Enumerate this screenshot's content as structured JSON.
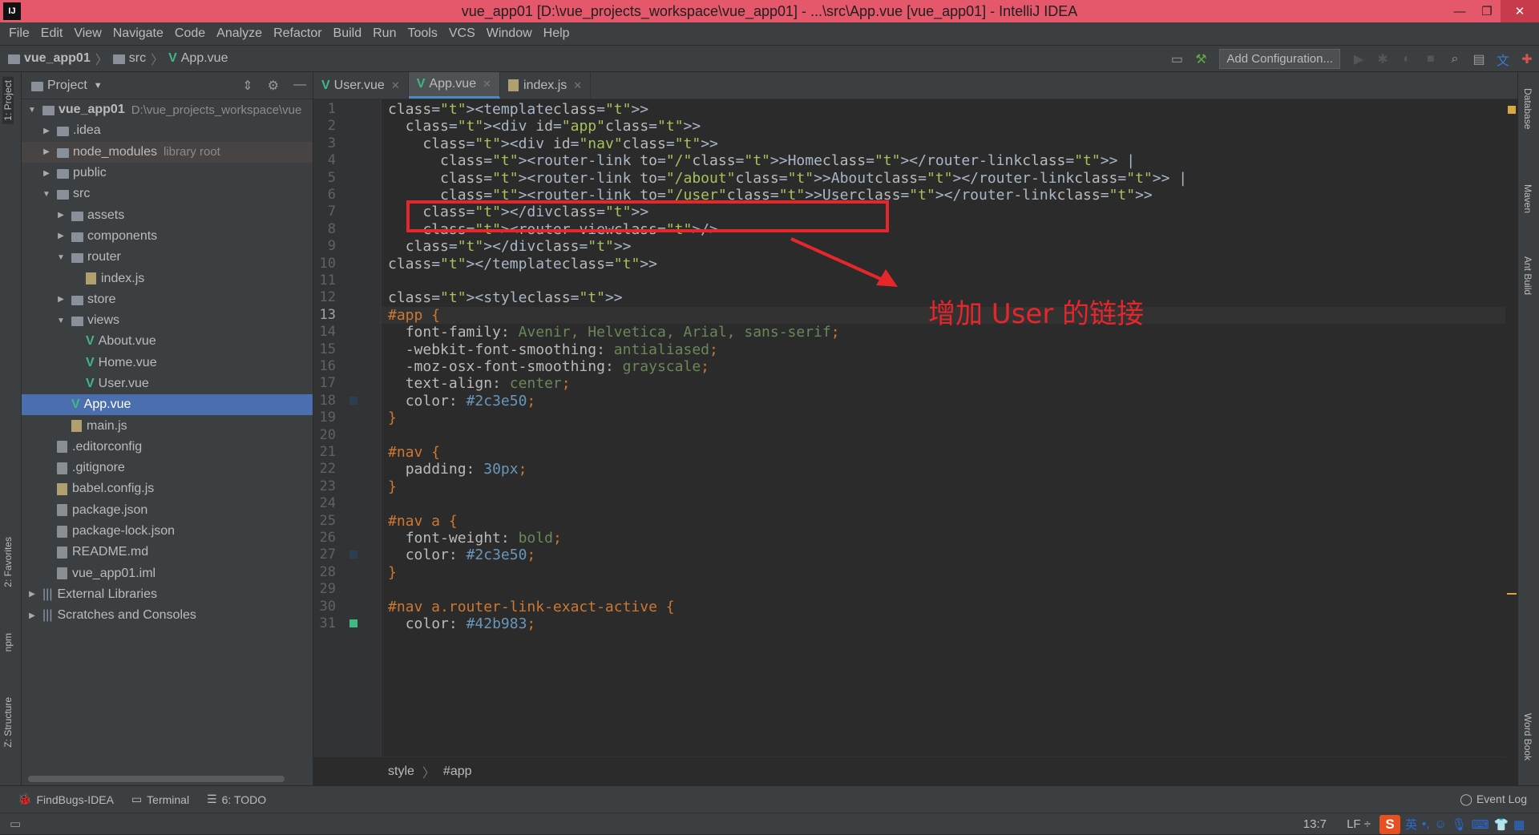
{
  "window": {
    "title": "vue_app01 [D:\\vue_projects_workspace\\vue_app01] - ...\\src\\App.vue [vue_app01] - IntelliJ IDEA",
    "minimize": "—",
    "maximize": "❐",
    "close": "✕"
  },
  "menu": [
    "File",
    "Edit",
    "View",
    "Navigate",
    "Code",
    "Analyze",
    "Refactor",
    "Build",
    "Run",
    "Tools",
    "VCS",
    "Window",
    "Help"
  ],
  "nav": {
    "project": "vue_app01",
    "folder": "src",
    "file": "App.vue",
    "add_config": "Add Configuration..."
  },
  "left_tabs": {
    "project": "1: Project",
    "favorites": "2: Favorites",
    "npm": "npm",
    "structure": "Z: Structure"
  },
  "right_tabs": {
    "database": "Database",
    "maven": "Maven",
    "ant": "Ant Build",
    "wordbook": "Word Book"
  },
  "project_panel": {
    "title": "Project",
    "tree": [
      {
        "label": "vue_app01",
        "hint": "D:\\vue_projects_workspace\\vue",
        "level": 0,
        "arrow": "▼",
        "icon": "folder"
      },
      {
        "label": ".idea",
        "level": 1,
        "arrow": "▶",
        "icon": "folder"
      },
      {
        "label": "node_modules",
        "hint": "library root",
        "level": 1,
        "arrow": "▶",
        "icon": "folder"
      },
      {
        "label": "public",
        "level": 1,
        "arrow": "▶",
        "icon": "folder"
      },
      {
        "label": "src",
        "level": 1,
        "arrow": "▼",
        "icon": "folder"
      },
      {
        "label": "assets",
        "level": 2,
        "arrow": "▶",
        "icon": "folder"
      },
      {
        "label": "components",
        "level": 2,
        "arrow": "▶",
        "icon": "folder"
      },
      {
        "label": "router",
        "level": 2,
        "arrow": "▼",
        "icon": "folder"
      },
      {
        "label": "index.js",
        "level": 3,
        "arrow": "",
        "icon": "js"
      },
      {
        "label": "store",
        "level": 2,
        "arrow": "▶",
        "icon": "folder"
      },
      {
        "label": "views",
        "level": 2,
        "arrow": "▼",
        "icon": "folder"
      },
      {
        "label": "About.vue",
        "level": 3,
        "arrow": "",
        "icon": "vue"
      },
      {
        "label": "Home.vue",
        "level": 3,
        "arrow": "",
        "icon": "vue"
      },
      {
        "label": "User.vue",
        "level": 3,
        "arrow": "",
        "icon": "vue"
      },
      {
        "label": "App.vue",
        "level": 2,
        "arrow": "",
        "icon": "vue",
        "selected": true
      },
      {
        "label": "main.js",
        "level": 2,
        "arrow": "",
        "icon": "js"
      },
      {
        "label": ".editorconfig",
        "level": 1,
        "arrow": "",
        "icon": "file"
      },
      {
        "label": ".gitignore",
        "level": 1,
        "arrow": "",
        "icon": "file"
      },
      {
        "label": "babel.config.js",
        "level": 1,
        "arrow": "",
        "icon": "js"
      },
      {
        "label": "package.json",
        "level": 1,
        "arrow": "",
        "icon": "file"
      },
      {
        "label": "package-lock.json",
        "level": 1,
        "arrow": "",
        "icon": "file"
      },
      {
        "label": "README.md",
        "level": 1,
        "arrow": "",
        "icon": "file"
      },
      {
        "label": "vue_app01.iml",
        "level": 1,
        "arrow": "",
        "icon": "file"
      },
      {
        "label": "External Libraries",
        "level": 0,
        "arrow": "▶",
        "icon": "lib"
      },
      {
        "label": "Scratches and Consoles",
        "level": 0,
        "arrow": "▶",
        "icon": "lib"
      }
    ]
  },
  "tabs": [
    {
      "label": "User.vue",
      "icon": "vue",
      "active": false
    },
    {
      "label": "App.vue",
      "icon": "vue",
      "active": true
    },
    {
      "label": "index.js",
      "icon": "js",
      "active": false
    }
  ],
  "code_lines": [
    "<template>",
    "  <div id=\"app\">",
    "    <div id=\"nav\">",
    "      <router-link to=\"/\">Home</router-link> |",
    "      <router-link to=\"/about\">About</router-link> |",
    "      <router-link to=\"/user\">User</router-link>",
    "    </div>",
    "    <router-view/>",
    "  </div>",
    "</template>",
    "",
    "<style>",
    "#app {",
    "  font-family: Avenir, Helvetica, Arial, sans-serif;",
    "  -webkit-font-smoothing: antialiased;",
    "  -moz-osx-font-smoothing: grayscale;",
    "  text-align: center;",
    "  color: #2c3e50;",
    "}",
    "",
    "#nav {",
    "  padding: 30px;",
    "}",
    "",
    "#nav a {",
    "  font-weight: bold;",
    "  color: #2c3e50;",
    "}",
    "",
    "#nav a.router-link-exact-active {",
    "  color: #42b983;"
  ],
  "current_line": 13,
  "annotation": {
    "text": "增加 User 的链接"
  },
  "editor_breadcrumbs": {
    "item1": "style",
    "item2": "#app"
  },
  "bottom_tools": [
    {
      "label": "FindBugs-IDEA",
      "icon": "bug-icon"
    },
    {
      "label": "Terminal",
      "icon": "terminal-icon"
    },
    {
      "label": "6: TODO",
      "icon": "todo-icon"
    }
  ],
  "event_log": "Event Log",
  "status": {
    "position": "13:7",
    "line_ending": "LF ÷"
  },
  "ime": {
    "logo": "S",
    "lang": "英"
  },
  "colors": {
    "title_bar": "#e5586c",
    "accent": "#4b6eaf",
    "annotation": "#e5262b",
    "vue_green": "#41b883"
  }
}
